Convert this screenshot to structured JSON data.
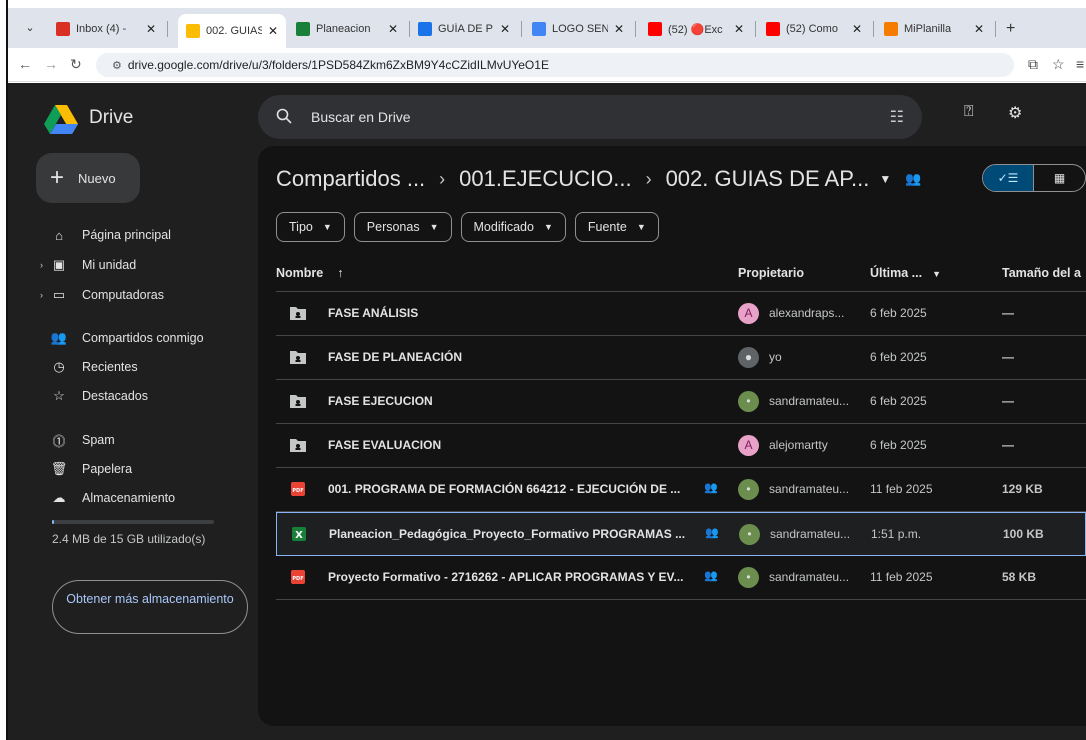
{
  "browser": {
    "tabs": [
      {
        "label": "Inbox (4) -",
        "icon": "gmail-icon",
        "color": "#d93025"
      },
      {
        "label": "002. GUIAS",
        "icon": "drive-icon",
        "color": "#fbbc04",
        "active": true
      },
      {
        "label": "Planeacion",
        "icon": "sheets-icon",
        "color": "#188038"
      },
      {
        "label": "GUÍA DE P",
        "icon": "docs-icon",
        "color": "#1a73e8"
      },
      {
        "label": "LOGO SEN",
        "icon": "google-icon",
        "color": "#4285f4"
      },
      {
        "label": "(52) 🔴Exc",
        "icon": "youtube-icon",
        "color": "#ff0000"
      },
      {
        "label": "(52) Como",
        "icon": "youtube-icon",
        "color": "#ff0000"
      },
      {
        "label": "MiPlanilla",
        "icon": "check-icon",
        "color": "#f57c00"
      }
    ],
    "new_tab": "+",
    "url": "drive.google.com/drive/u/3/folders/1PSD584Zkm6ZxBM9Y4cCZidILMvUYeO1E"
  },
  "drive": {
    "brand": "Drive",
    "search_placeholder": "Buscar en Drive",
    "new_button": "Nuevo",
    "sidebar": [
      {
        "label": "Página principal",
        "icon": "home-icon",
        "glyph": "⌂"
      },
      {
        "label": "Mi unidad",
        "icon": "my-drive-icon",
        "glyph": "▣",
        "expandable": true
      },
      {
        "label": "Computadoras",
        "icon": "computer-icon",
        "glyph": "▭",
        "expandable": true
      },
      {
        "label": "Compartidos conmigo",
        "icon": "people-icon",
        "glyph": "👥"
      },
      {
        "label": "Recientes",
        "icon": "clock-icon",
        "glyph": "◷"
      },
      {
        "label": "Destacados",
        "icon": "star-icon",
        "glyph": "☆"
      },
      {
        "label": "Spam",
        "icon": "spam-icon",
        "glyph": "⓵"
      },
      {
        "label": "Papelera",
        "icon": "trash-icon",
        "glyph": "🗑"
      },
      {
        "label": "Almacenamiento",
        "icon": "cloud-icon",
        "glyph": "☁"
      }
    ],
    "storage": {
      "text": "2.4 MB de 15 GB utilizado(s)",
      "used_fraction": 0.0002
    },
    "more_storage": "Obtener más almacenamiento",
    "breadcrumb": [
      "Compartidos ...",
      "001.EJECUCIO...",
      "002. GUIAS DE AP..."
    ],
    "filters": [
      "Tipo",
      "Personas",
      "Modificado",
      "Fuente"
    ],
    "columns": {
      "name": "Nombre",
      "sort": "↑",
      "owner": "Propietario",
      "modified": "Última ...",
      "size": "Tamaño del a"
    },
    "files": [
      {
        "name": "FASE ANÁLISIS",
        "type": "folder",
        "owner": "alexandraps...",
        "avatar": "A",
        "avatar_color": "#e8a2c8",
        "modified": "6 feb 2025",
        "size": "—",
        "shared": false
      },
      {
        "name": "FASE DE PLANEACIÓN",
        "type": "folder",
        "owner": "yo",
        "avatar": "●",
        "avatar_color": "#5f6368",
        "modified": "6 feb 2025",
        "size": "—",
        "shared": false
      },
      {
        "name": "FASE EJECUCION",
        "type": "folder",
        "owner": "sandramateu...",
        "avatar": "•",
        "avatar_color": "#6b8e4e",
        "modified": "6 feb 2025",
        "size": "—",
        "shared": false
      },
      {
        "name": "FASE EVALUACION",
        "type": "folder",
        "owner": "alejomartty",
        "avatar": "A",
        "avatar_color": "#e8a2c8",
        "modified": "6 feb 2025",
        "size": "—",
        "shared": false
      },
      {
        "name": "001. PROGRAMA DE FORMACIÓN 664212 - EJECUCIÓN DE ...",
        "type": "pdf",
        "owner": "sandramateu...",
        "avatar": "•",
        "avatar_color": "#6b8e4e",
        "modified": "11 feb 2025",
        "size": "129 KB",
        "shared": true
      },
      {
        "name": "Planeacion_Pedagógica_Proyecto_Formativo PROGRAMAS ...",
        "type": "xlsx",
        "owner": "sandramateu...",
        "avatar": "•",
        "avatar_color": "#6b8e4e",
        "modified": "1:51 p.m.",
        "size": "100 KB",
        "shared": true,
        "selected": true
      },
      {
        "name": "Proyecto Formativo - 2716262 - APLICAR PROGRAMAS Y EV...",
        "type": "pdf",
        "owner": "sandramateu...",
        "avatar": "•",
        "avatar_color": "#6b8e4e",
        "modified": "11 feb 2025",
        "size": "58 KB",
        "shared": true
      }
    ]
  }
}
